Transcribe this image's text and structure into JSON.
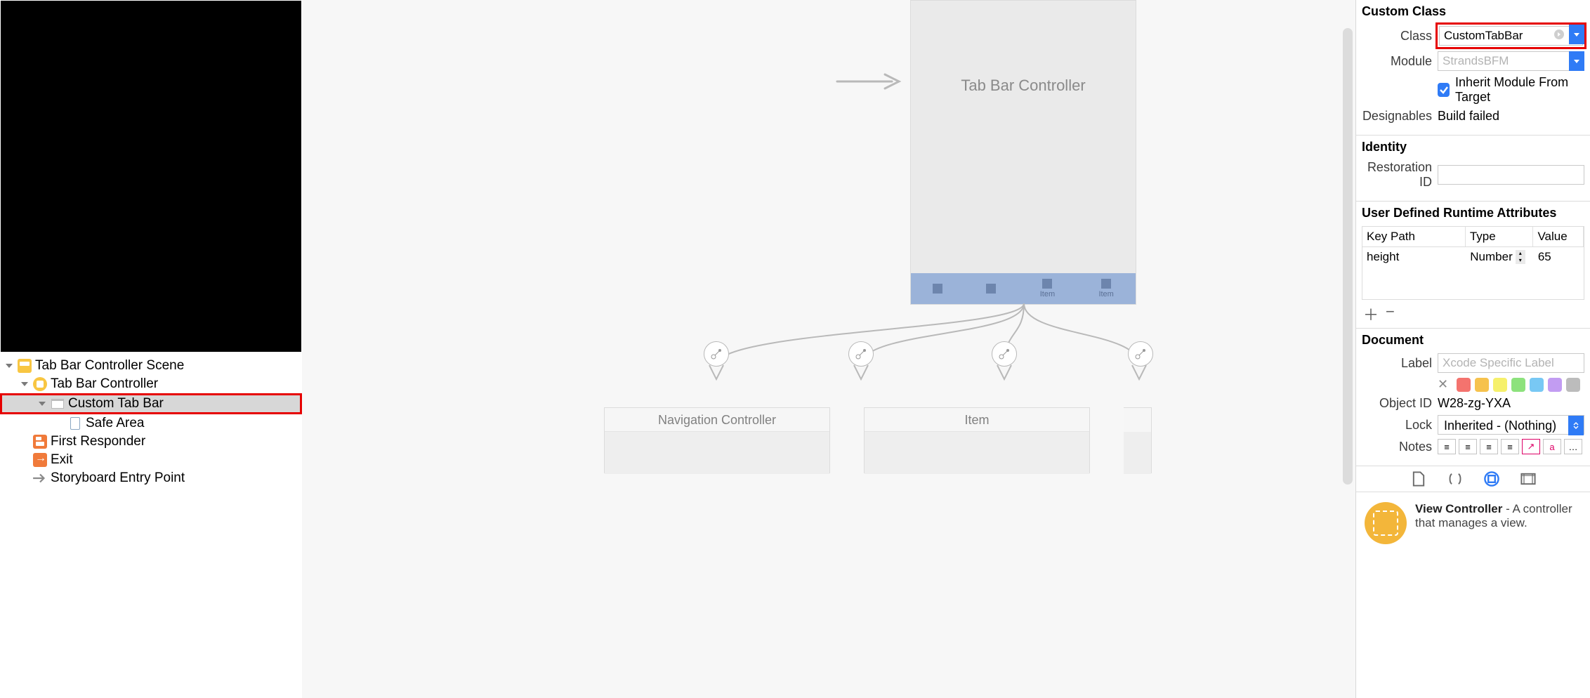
{
  "outline": {
    "scene_label": "Tab Bar Controller Scene",
    "vc_label": "Tab Bar Controller",
    "custom_tabbar_label": "Custom Tab Bar",
    "safe_area_label": "Safe Area",
    "first_responder_label": "First Responder",
    "exit_label": "Exit",
    "entry_point_label": "Storyboard Entry Point"
  },
  "canvas": {
    "tbc_title": "Tab Bar Controller",
    "tab_item_label": "Item",
    "child_nav_title": "Navigation Controller",
    "child_item_title": "Item"
  },
  "inspector": {
    "custom_class": {
      "section_title": "Custom Class",
      "class_label": "Class",
      "class_value": "CustomTabBar",
      "module_label": "Module",
      "module_placeholder": "StrandsBFM",
      "inherit_label": "Inherit Module From Target",
      "designables_label": "Designables",
      "designables_value": "Build failed"
    },
    "identity": {
      "section_title": "Identity",
      "restoration_id_label": "Restoration ID"
    },
    "udra": {
      "section_title": "User Defined Runtime Attributes",
      "col_key": "Key Path",
      "col_type": "Type",
      "col_value": "Value",
      "row_key": "height",
      "row_type": "Number",
      "row_value": "65"
    },
    "document": {
      "section_title": "Document",
      "label_label": "Label",
      "label_placeholder": "Xcode Specific Label",
      "object_id_label": "Object ID",
      "object_id_value": "W28-zg-YXA",
      "lock_label": "Lock",
      "lock_value": "Inherited - (Nothing)",
      "notes_label": "Notes",
      "swatches": [
        "#f4736e",
        "#f6c24d",
        "#f6f06b",
        "#8de27d",
        "#78c8f4",
        "#c29cf2",
        "#bcbcbc"
      ]
    },
    "library": {
      "title": "View Controller",
      "desc": " - A controller that manages a view."
    }
  }
}
